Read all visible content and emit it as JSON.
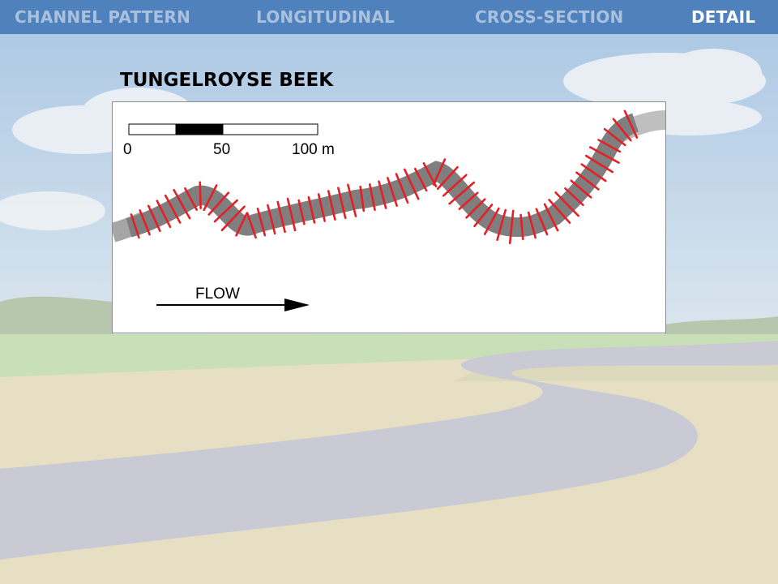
{
  "nav": {
    "tabs": [
      {
        "label": "CHANNEL PATTERN",
        "active": false
      },
      {
        "label": "LONGITUDINAL",
        "active": false
      },
      {
        "label": "CROSS-SECTION",
        "active": false
      },
      {
        "label": "DETAIL",
        "active": true
      }
    ]
  },
  "title": "TUNGELROYSE BEEK",
  "scale_bar": {
    "ticks": [
      "0",
      "50",
      "100 m"
    ]
  },
  "flow_label": "FLOW",
  "colors": {
    "nav": "#4f81bd",
    "nav_inactive_text": "#a9c1dd",
    "channel": "#7f7f7f",
    "transect": "#e41f26"
  }
}
